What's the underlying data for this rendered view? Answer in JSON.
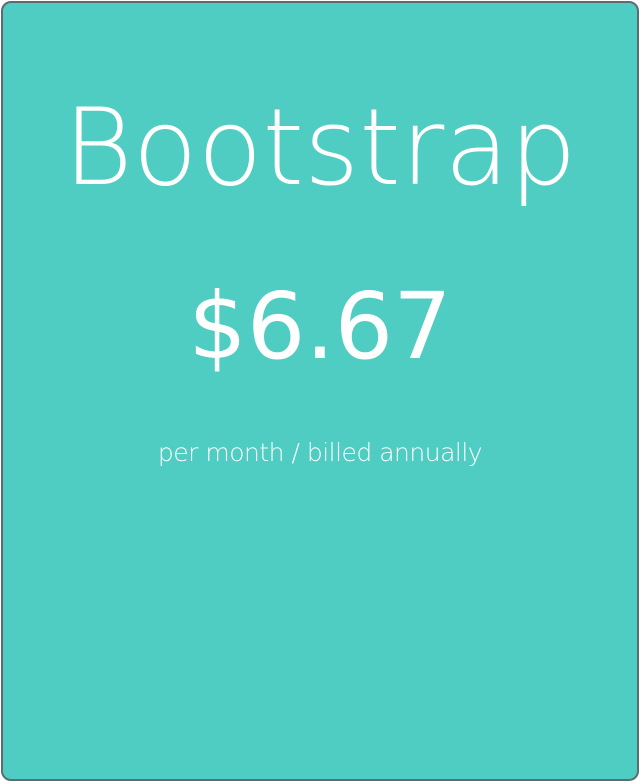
{
  "pricing_card": {
    "plan_name": "Bootstrap",
    "price": "$6.67",
    "billing_note": "per month / billed annually"
  },
  "colors": {
    "card_background": "#50cdc2",
    "card_border": "#5d6b73",
    "text": "#ffffff"
  }
}
